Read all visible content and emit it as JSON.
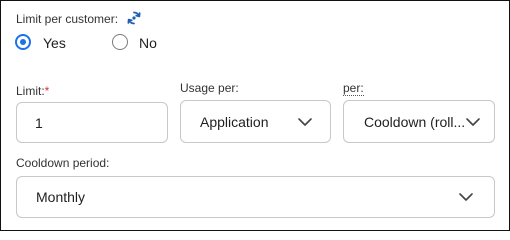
{
  "limit_per_customer": {
    "label": "Limit per customer:",
    "icon": "refresh-icon",
    "options": [
      {
        "label": "Yes",
        "selected": true
      },
      {
        "label": "No",
        "selected": false
      }
    ]
  },
  "limit": {
    "label": "Limit:",
    "required_mark": "*",
    "value": "1"
  },
  "usage_per": {
    "label": "Usage per:",
    "selected": "Application"
  },
  "per": {
    "label": "per:",
    "selected": "Cooldown (roll..."
  },
  "cooldown_period": {
    "label": "Cooldown period:",
    "selected": "Monthly"
  },
  "colors": {
    "accent": "#1a73e8",
    "required": "#d93025",
    "border": "#c8c8c8"
  }
}
